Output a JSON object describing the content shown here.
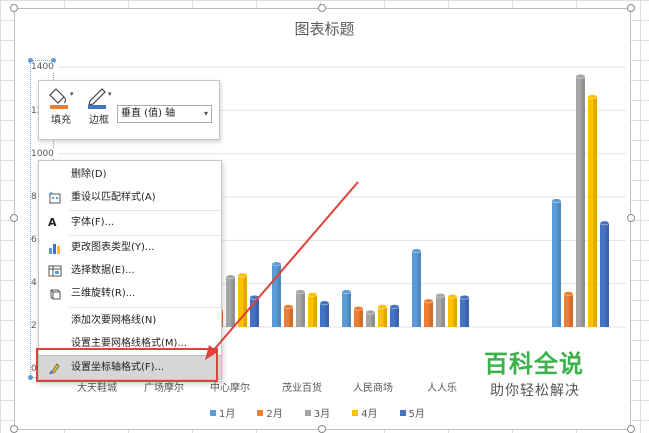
{
  "chart": {
    "title": "图表标题",
    "y_ticks": [
      "1400",
      "12",
      "1000",
      "8",
      "6",
      "4",
      "2",
      "0"
    ],
    "colors": {
      "jan": "#5b9bd5",
      "feb": "#ed7d31",
      "mar": "#a5a5a5",
      "apr": "#ffc000",
      "may": "#4472c4"
    }
  },
  "chart_data": {
    "type": "bar",
    "title": "图表标题",
    "categories": [
      "大天鞋城",
      "广场摩尔",
      "中心摩尔",
      "茂业百货",
      "人民商场",
      "人人乐",
      "",
      ""
    ],
    "series": [
      {
        "name": "1月",
        "values": [
          null,
          null,
          230,
          340,
          190,
          410,
          null,
          680
        ]
      },
      {
        "name": "2月",
        "values": [
          null,
          null,
          90,
          110,
          100,
          140,
          null,
          180
        ]
      },
      {
        "name": "3月",
        "values": [
          null,
          100,
          270,
          190,
          80,
          170,
          null,
          1350
        ]
      },
      {
        "name": "4月",
        "values": [
          null,
          null,
          280,
          175,
          110,
          165,
          null,
          1240
        ]
      },
      {
        "name": "5月",
        "values": [
          null,
          null,
          160,
          130,
          110,
          160,
          null,
          560
        ]
      }
    ],
    "ylim": [
      0,
      1400
    ],
    "legend_position": "bottom"
  },
  "mini_toolbar": {
    "fill_label": "填充",
    "outline_label": "边框",
    "element_selector": "垂直 (值) 轴"
  },
  "context_menu": {
    "items": [
      {
        "label": "删除(D)"
      },
      {
        "label": "重设以匹配样式(A)"
      },
      {
        "label": "字体(F)..."
      },
      {
        "label": "更改图表类型(Y)..."
      },
      {
        "label": "选择数据(E)..."
      },
      {
        "label": "三维旋转(R)..."
      },
      {
        "label": "添加次要网格线(N)"
      },
      {
        "label": "设置主要网格线格式(M)..."
      },
      {
        "label": "设置坐标轴格式(F)..."
      }
    ]
  },
  "watermark": {
    "title": "百科全说",
    "subtitle": "助你轻松解决"
  }
}
